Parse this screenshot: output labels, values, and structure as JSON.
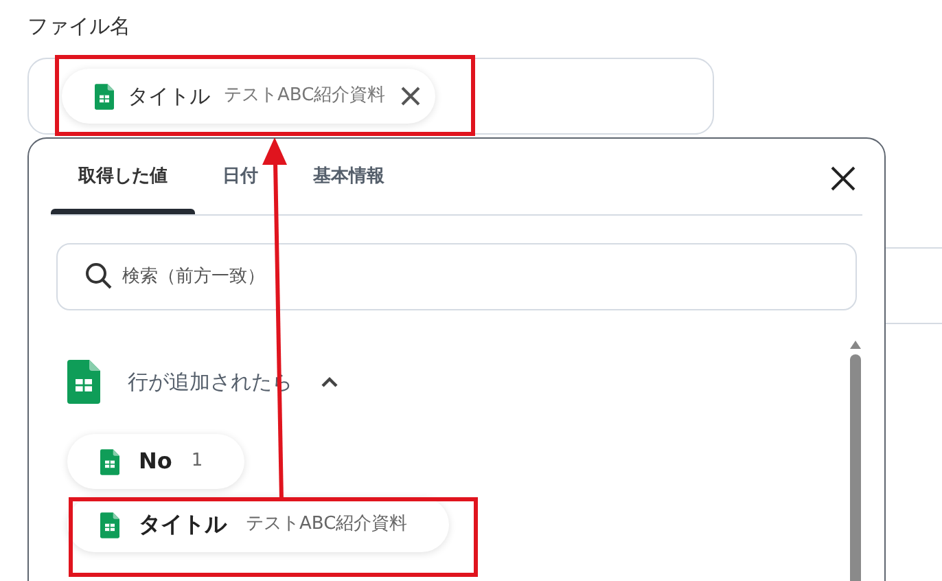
{
  "field_label": "ファイル名",
  "field": {
    "chip": {
      "label": "タイトル",
      "value": "テストABC紹介資料"
    }
  },
  "panel": {
    "tabs": [
      {
        "label": "取得した値",
        "selected": true
      },
      {
        "label": "日付",
        "selected": false
      },
      {
        "label": "基本情報",
        "selected": false
      }
    ],
    "search": {
      "placeholder": "検索（前方一致）"
    },
    "group": {
      "title": "行が追加されたら",
      "expanded": true,
      "items": [
        {
          "label": "No",
          "value": "1"
        },
        {
          "label": "タイトル",
          "value": "テストABC紹介資料"
        }
      ]
    }
  }
}
